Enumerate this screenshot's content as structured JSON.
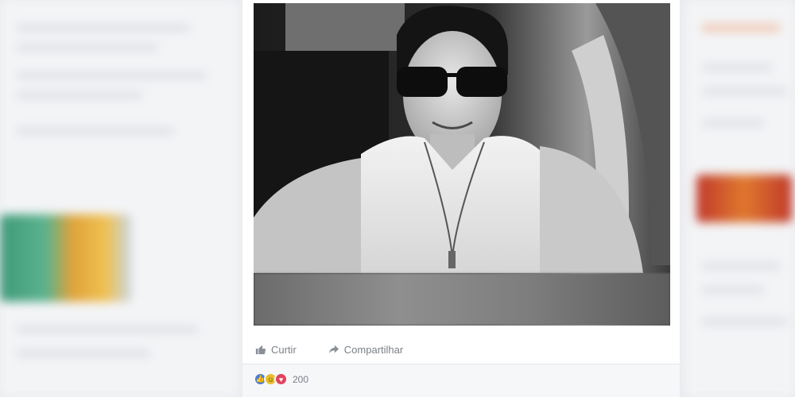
{
  "post": {
    "actions": {
      "like_label": "Curtir",
      "share_label": "Compartilhar"
    },
    "reactions": {
      "count": "200",
      "types": [
        "like-icon",
        "haha-icon",
        "love-icon"
      ]
    }
  },
  "colors": {
    "background": "#e9ebee",
    "card": "#ffffff",
    "like": "#4a7fd4",
    "haha": "#e8c02c",
    "love": "#e0455c",
    "muted_text": "#7a7f87"
  }
}
